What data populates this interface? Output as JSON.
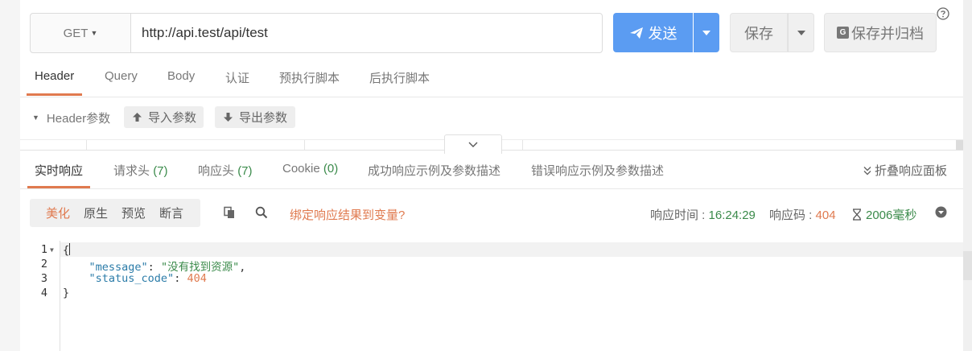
{
  "request": {
    "method": "GET",
    "url": "http://api.test/api/test",
    "send_label": "发送",
    "save_label": "保存",
    "archive_label": "保存并归档",
    "archive_icon_letter": "G"
  },
  "request_tabs": [
    "Header",
    "Query",
    "Body",
    "认证",
    "预执行脚本",
    "后执行脚本"
  ],
  "header_params": {
    "label": "Header参数",
    "import_label": "导入参数",
    "export_label": "导出参数"
  },
  "response_tabs": {
    "realtime": "实时响应",
    "req_headers": "请求头",
    "req_headers_count": "(7)",
    "res_headers": "响应头",
    "res_headers_count": "(7)",
    "cookie": "Cookie",
    "cookie_count": "(0)",
    "success_examples": "成功响应示例及参数描述",
    "error_examples": "错误响应示例及参数描述",
    "collapse": "折叠响应面板"
  },
  "response_toolbar": {
    "formats": [
      "美化",
      "原生",
      "预览",
      "断言"
    ],
    "bind_link": "绑定响应结果到变量?",
    "time_label": "响应时间 : ",
    "time_value": "16:24:29",
    "code_label": "响应码 : ",
    "code_value": "404",
    "duration": "2006毫秒"
  },
  "response_body": {
    "line_numbers": [
      "1",
      "2",
      "3",
      "4"
    ],
    "open_brace": "{",
    "key1": "\"message\"",
    "val1": "\"没有找到资源\"",
    "key2": "\"status_code\"",
    "val2": "404",
    "close_brace": "}"
  },
  "colors": {
    "primary": "#5b9cf2",
    "accent": "#e07a4f",
    "success": "#3a8a4a"
  }
}
